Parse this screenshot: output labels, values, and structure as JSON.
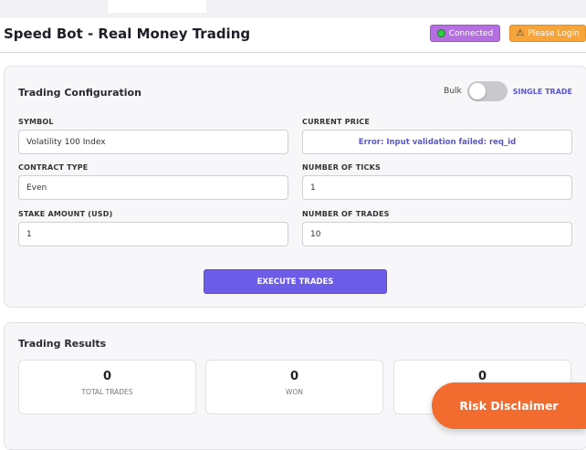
{
  "header": {
    "title": "Speed Bot - Real Money Trading",
    "connected_label": "Connected",
    "login_label": "Please Login",
    "warning_glyph": "⚠"
  },
  "config": {
    "title": "Trading Configuration",
    "bulk_label": "Bulk",
    "single_trade_label": "SINGLE TRADE",
    "mode_toggle_on": false,
    "symbol": {
      "label": "SYMBOL",
      "value": "Volatility 100 Index"
    },
    "current_price": {
      "label": "CURRENT PRICE",
      "value": "Error: Input validation failed: req_id"
    },
    "contract_type": {
      "label": "CONTRACT TYPE",
      "value": "Even"
    },
    "number_of_ticks": {
      "label": "NUMBER OF TICKS",
      "value": "1"
    },
    "stake_amount": {
      "label": "STAKE AMOUNT (USD)",
      "value": "1"
    },
    "number_of_trades": {
      "label": "NUMBER OF TRADES",
      "value": "10"
    },
    "execute_label": "EXECUTE TRADES"
  },
  "results": {
    "title": "Trading Results",
    "stats": [
      {
        "value": "0",
        "label": "TOTAL TRADES"
      },
      {
        "value": "0",
        "label": "WON"
      },
      {
        "value": "0",
        "label": ""
      }
    ]
  },
  "risk_disclaimer_label": "Risk Disclaimer",
  "colors": {
    "accent": "#6c5ce7",
    "connected": "#b56fe0",
    "login": "#f7a53a",
    "risk": "#f26b2f",
    "error_text": "#5b55d8"
  }
}
